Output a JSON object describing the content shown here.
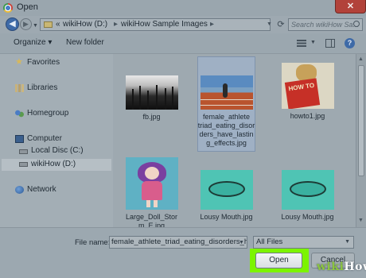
{
  "window": {
    "title": "Open",
    "close_label": "✕"
  },
  "address_bar": {
    "overflow": "«",
    "crumbs": [
      "wikiHow (D:)",
      "wikiHow Sample Images"
    ],
    "separator": "▸"
  },
  "search": {
    "placeholder": "Search wikiHow Sa..."
  },
  "toolbar": {
    "organize_label": "Organize ▾",
    "new_folder_label": "New folder"
  },
  "nav": {
    "items": [
      {
        "label": "Favorites",
        "icon": "star-icon"
      },
      {
        "label": "Libraries",
        "icon": "libraries-icon"
      },
      {
        "label": "Homegroup",
        "icon": "homegroup-icon"
      },
      {
        "label": "Computer",
        "icon": "computer-icon"
      },
      {
        "label": "Local Disc (C:)",
        "icon": "drive-icon"
      },
      {
        "label": "wikiHow (D:)",
        "icon": "drive-icon",
        "selected": true
      },
      {
        "label": "Network",
        "icon": "network-icon"
      }
    ]
  },
  "files": [
    {
      "name": "fb.jpg"
    },
    {
      "name": "female_athlete_triad_eating_disorders_have_lasting_effects.jpg",
      "lines": [
        "female_athlete",
        "triad_eating_disor",
        "ders_have_lastin",
        "g_effects.jpg"
      ],
      "selected": true
    },
    {
      "name": "howto1.jpg",
      "book_text": "HOW TO"
    },
    {
      "name": "Large_Doll_Storm_E.jpg",
      "lines": [
        "Large_Doll_Stor",
        "m_E.jpg"
      ]
    },
    {
      "name": "Lousy Mouth.jpg"
    },
    {
      "name": "Lousy Mouth.jpg"
    }
  ],
  "bottom": {
    "file_name_label": "File name:",
    "file_name_value": "female_athlete_triad_eating_disorders_h",
    "filter_value": "All Files",
    "open_label": "Open",
    "cancel_label": "Cancel"
  },
  "watermark": {
    "prefix": "wiki",
    "suffix": "How"
  },
  "colors": {
    "highlight": "#7cf400",
    "selection": "#9fb0c4",
    "accent": "#3e6aa7"
  }
}
